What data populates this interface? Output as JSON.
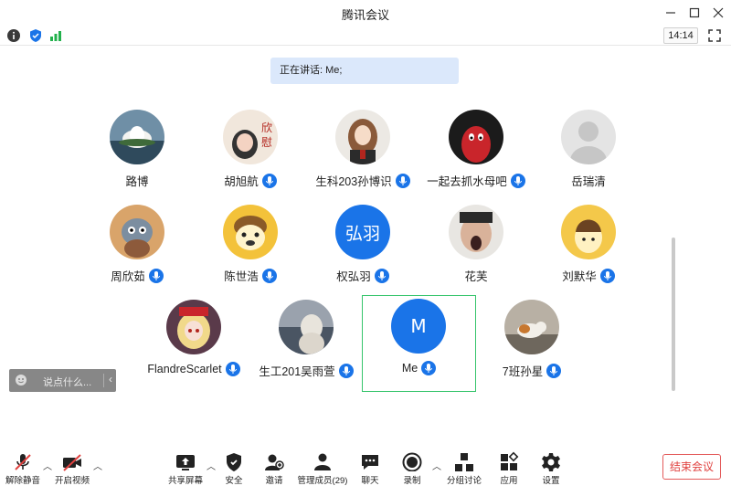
{
  "window": {
    "title": "腾讯会议"
  },
  "infobar": {
    "clock": "14:14"
  },
  "speaking": {
    "text": "正在讲话: Me;"
  },
  "participants": [
    {
      "name": "路博",
      "mic": false
    },
    {
      "name": "胡旭航",
      "mic": true
    },
    {
      "name": "生科203孙博识",
      "mic": true
    },
    {
      "name": "一起去抓水母吧",
      "mic": true
    },
    {
      "name": "岳瑞清",
      "mic": false
    },
    {
      "name": "周欣茹",
      "mic": true
    },
    {
      "name": "陈世浩",
      "mic": true
    },
    {
      "name": "权弘羽",
      "mic": true,
      "initials": "弘羽"
    },
    {
      "name": "花芙",
      "mic": false
    },
    {
      "name": "刘默华",
      "mic": true
    },
    {
      "name": "FlandreScarlet",
      "mic": true
    },
    {
      "name": "生工201吴雨萱",
      "mic": true
    },
    {
      "name": "Me",
      "mic": true,
      "initials": "M"
    },
    {
      "name": "7班孙星",
      "mic": true
    }
  ],
  "chat": {
    "placeholder": "说点什么..."
  },
  "toolbar": {
    "unmute": "解除静音",
    "video": "开启视频",
    "share": "共享屏幕",
    "security": "安全",
    "invite": "邀请",
    "members": "管理成员(29)",
    "chat": "聊天",
    "record": "录制",
    "breakout": "分组讨论",
    "apps": "应用",
    "settings": "设置",
    "end": "结束会议"
  },
  "colors": {
    "accent": "#1a74e8",
    "end": "#e0413f",
    "active_border": "#35c46b"
  }
}
